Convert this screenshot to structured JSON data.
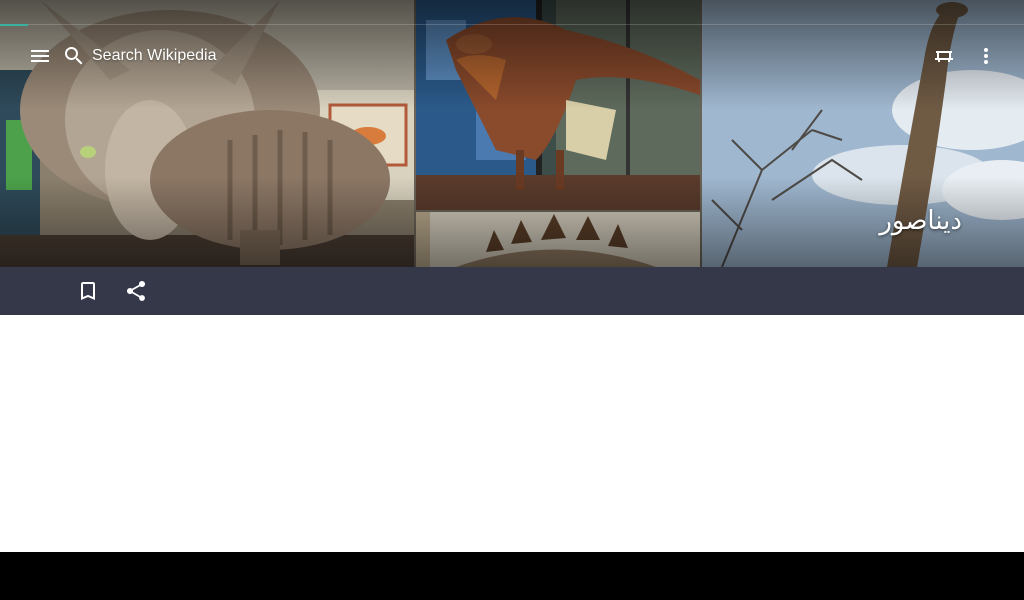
{
  "toolbar": {
    "menu_icon": "menu-icon",
    "search_icon": "search-icon",
    "search_placeholder": "Search Wikipedia",
    "reading_lists_icon": "reading-lists-icon",
    "overflow_icon": "more-vert-icon"
  },
  "article": {
    "title": "ديناصور"
  },
  "actions": {
    "save_icon": "bookmark-icon",
    "share_icon": "share-icon"
  },
  "colors": {
    "action_bar": "#353849",
    "progress_accent": "#3ab09e",
    "content_background": "#ffffff",
    "system_nav": "#000000"
  }
}
